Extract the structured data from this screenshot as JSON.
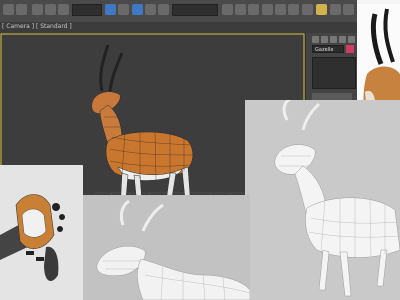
{
  "app": {
    "viewport_label": "[ Camera ] [ Standard ]",
    "object_name": "Gazelle",
    "accent_color": "#3f79c6",
    "object_color": "#d23b63"
  },
  "toolbar": {
    "icons": [
      "undo-icon",
      "redo-icon",
      "link-icon",
      "unlink-icon",
      "bind-icon",
      "select-icon",
      "select-region-icon",
      "move-icon",
      "rotate-icon",
      "scale-icon",
      "snap-icon",
      "angle-snap-icon",
      "percent-snap-icon",
      "mirror-icon",
      "align-icon",
      "layers-icon",
      "curve-editor-icon",
      "material-editor-icon",
      "render-setup-icon",
      "render-frame-icon",
      "render-icon"
    ]
  },
  "command_panel": {
    "tabs": [
      "create-tab",
      "modify-tab",
      "hierarchy-tab",
      "motion-tab",
      "display-tab",
      "utilities-tab"
    ]
  }
}
